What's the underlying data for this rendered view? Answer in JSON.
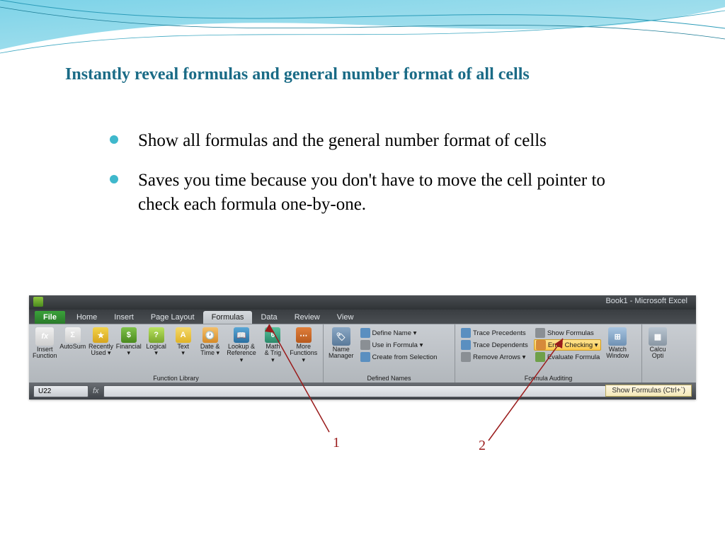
{
  "slide": {
    "title": "Instantly reveal formulas and general number format of all cells",
    "bullets": [
      "Show all formulas and the general number format of cells",
      "Saves you time because you don't have to move the cell pointer to check each formula one-by-one."
    ]
  },
  "ribbon": {
    "doc_title": "Book1 - Microsoft Excel",
    "tabs": {
      "file": "File",
      "items": [
        "Home",
        "Insert",
        "Page Layout",
        "Formulas",
        "Data",
        "Review",
        "View"
      ],
      "active": "Formulas"
    },
    "groups": {
      "function_library": {
        "label": "Function Library",
        "insert_function": "Insert\nFunction",
        "autosum": "AutoSum",
        "recently": "Recently\nUsed ▾",
        "financial": "Financial\n▾",
        "logical": "Logical\n▾",
        "text": "Text\n▾",
        "date_time": "Date &\nTime ▾",
        "lookup": "Lookup &\nReference ▾",
        "math": "Math\n& Trig ▾",
        "more": "More\nFunctions ▾"
      },
      "defined_names": {
        "label": "Defined Names",
        "name_manager": "Name\nManager",
        "define_name": "Define Name ▾",
        "use_in_formula": "Use in Formula ▾",
        "create_from_selection": "Create from Selection"
      },
      "formula_auditing": {
        "label": "Formula Auditing",
        "trace_precedents": "Trace Precedents",
        "trace_dependents": "Trace Dependents",
        "remove_arrows": "Remove Arrows ▾",
        "show_formulas": "Show Formulas",
        "error_checking": "Error Checking ▾",
        "evaluate_formula": "Evaluate Formula",
        "watch_window": "Watch\nWindow"
      },
      "calculation": {
        "calc_options": "Calcu\nOpti"
      }
    },
    "namebox": "U22",
    "tooltip": "Show Formulas (Ctrl+`)"
  },
  "callouts": {
    "one": "1",
    "two": "2"
  }
}
